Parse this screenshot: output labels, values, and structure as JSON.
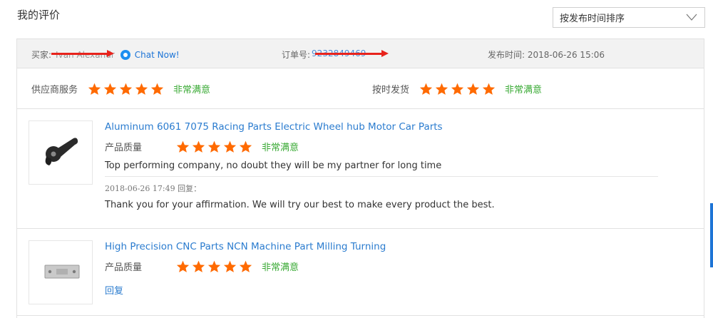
{
  "page": {
    "title": "我的评价"
  },
  "sort": {
    "selected": "按发布时间排序"
  },
  "order": {
    "buyer_label": "买家:",
    "buyer_name": "Ivan Alexandr",
    "chat_label": "Chat Now!",
    "order_label": "订单号:",
    "order_number": "9232849469",
    "time_label": "发布时间:",
    "time_value": "2018-06-26 15:06"
  },
  "service": [
    {
      "label": "供应商服务",
      "rating": 5,
      "verdict": "非常满意"
    },
    {
      "label": "按时发货",
      "rating": 5,
      "verdict": "非常满意"
    }
  ],
  "items": [
    {
      "title": "Aluminum 6061 7075 Racing Parts Electric Wheel hub Motor Car Parts",
      "quality_label": "产品质量",
      "rating": 5,
      "verdict": "非常满意",
      "comment": "Top performing company, no doubt they will be my partner for long time",
      "reply_meta": "2018-06-26 17:49   回复：",
      "reply_text": "Thank you for your affirmation. We will try our best to make every product the best."
    },
    {
      "title": "High Precision CNC Parts NCN Machine Part Milling Turning",
      "quality_label": "产品质量",
      "rating": 5,
      "verdict": "非常满意",
      "reply_link": "回复"
    }
  ],
  "colors": {
    "star": "#ff6a00",
    "verdict": "#3aaa35",
    "link": "#2b7ccf",
    "redaction": "#e8231c"
  }
}
